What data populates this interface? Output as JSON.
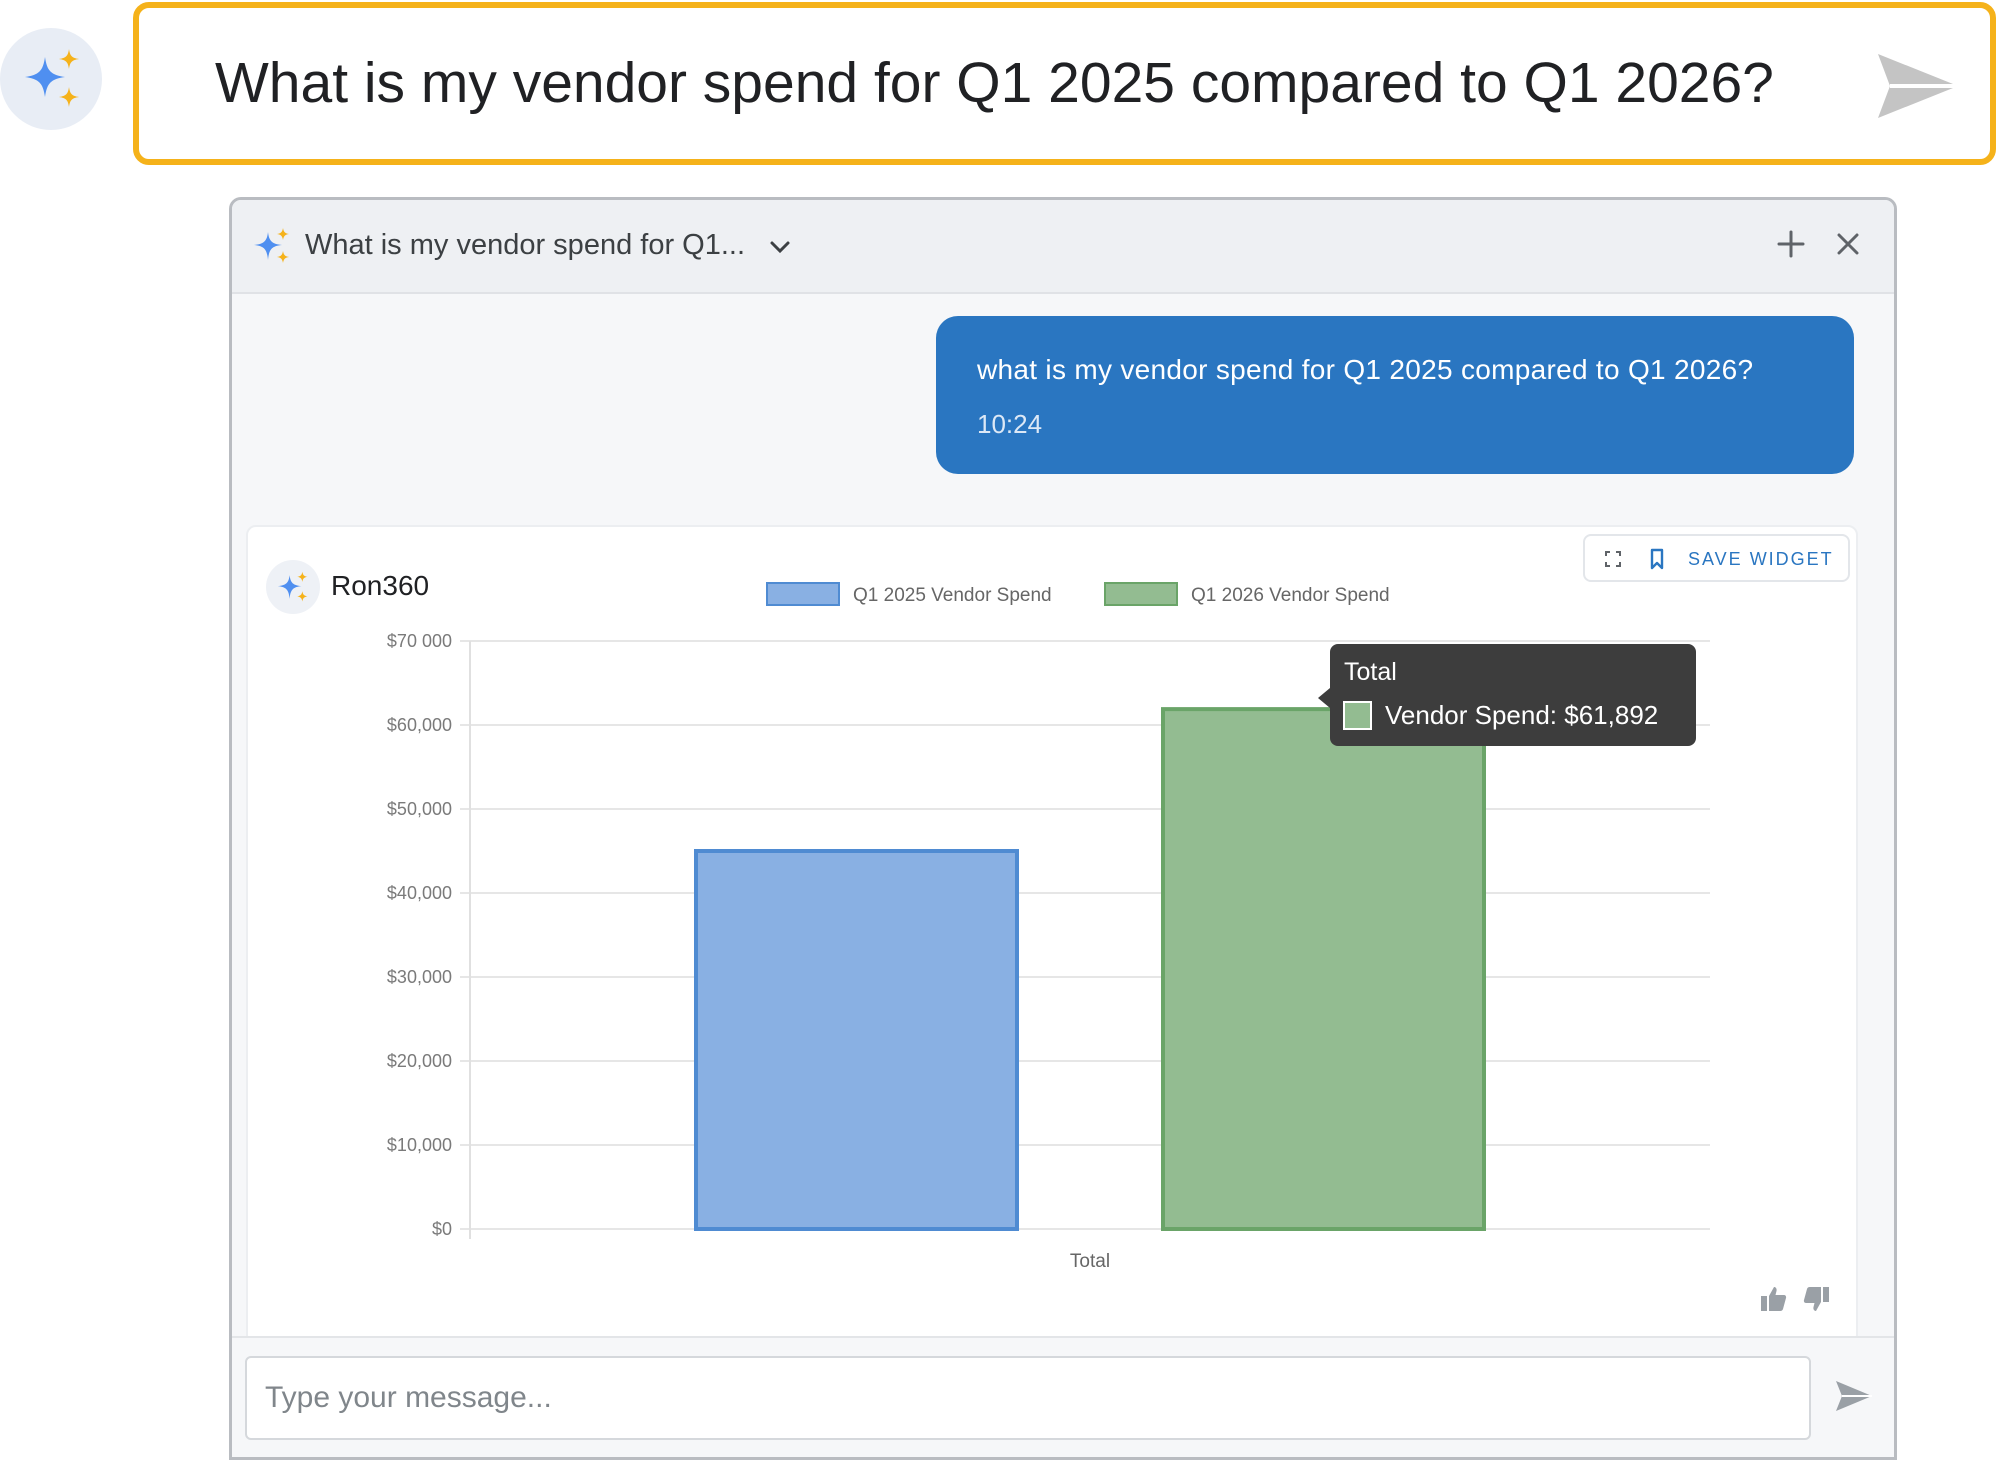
{
  "top_bar": {
    "query": "What is my vendor spend for Q1 2025 compared to Q1 2026?"
  },
  "chat": {
    "header_title": "What is my vendor spend for Q1...",
    "user_message": "what is my vendor spend for Q1 2025 compared to Q1 2026?",
    "user_time": "10:24",
    "bot_name": "Ron360",
    "save_widget_label": "SAVE WIDGET",
    "input_placeholder": "Type your message..."
  },
  "colors": {
    "accent": "#2a76c1",
    "highlight_border": "#f5b21a",
    "series_2025_fill": "#89b0e3",
    "series_2025_stroke": "#4f8bd2",
    "series_2026_fill": "#93bc91",
    "series_2026_stroke": "#6aa468"
  },
  "chart_data": {
    "type": "bar",
    "categories": [
      "Total"
    ],
    "series": [
      {
        "name": "Q1 2025 Vendor Spend",
        "values": [
          45000
        ]
      },
      {
        "name": "Q1 2026 Vendor Spend",
        "values": [
          61892
        ]
      }
    ],
    "ylim": [
      0,
      70000
    ],
    "yticks": [
      {
        "value": 0,
        "label": "$0"
      },
      {
        "value": 10000,
        "label": "$10,000"
      },
      {
        "value": 20000,
        "label": "$20,000"
      },
      {
        "value": 30000,
        "label": "$30,000"
      },
      {
        "value": 40000,
        "label": "$40,000"
      },
      {
        "value": 50000,
        "label": "$50,000"
      },
      {
        "value": 60000,
        "label": "$60,000"
      },
      {
        "value": 70000,
        "label": "$70 000"
      }
    ],
    "legend_position": "top",
    "grid": true,
    "tooltip": {
      "title": "Total",
      "line": "Vendor Spend: $61,892"
    }
  }
}
